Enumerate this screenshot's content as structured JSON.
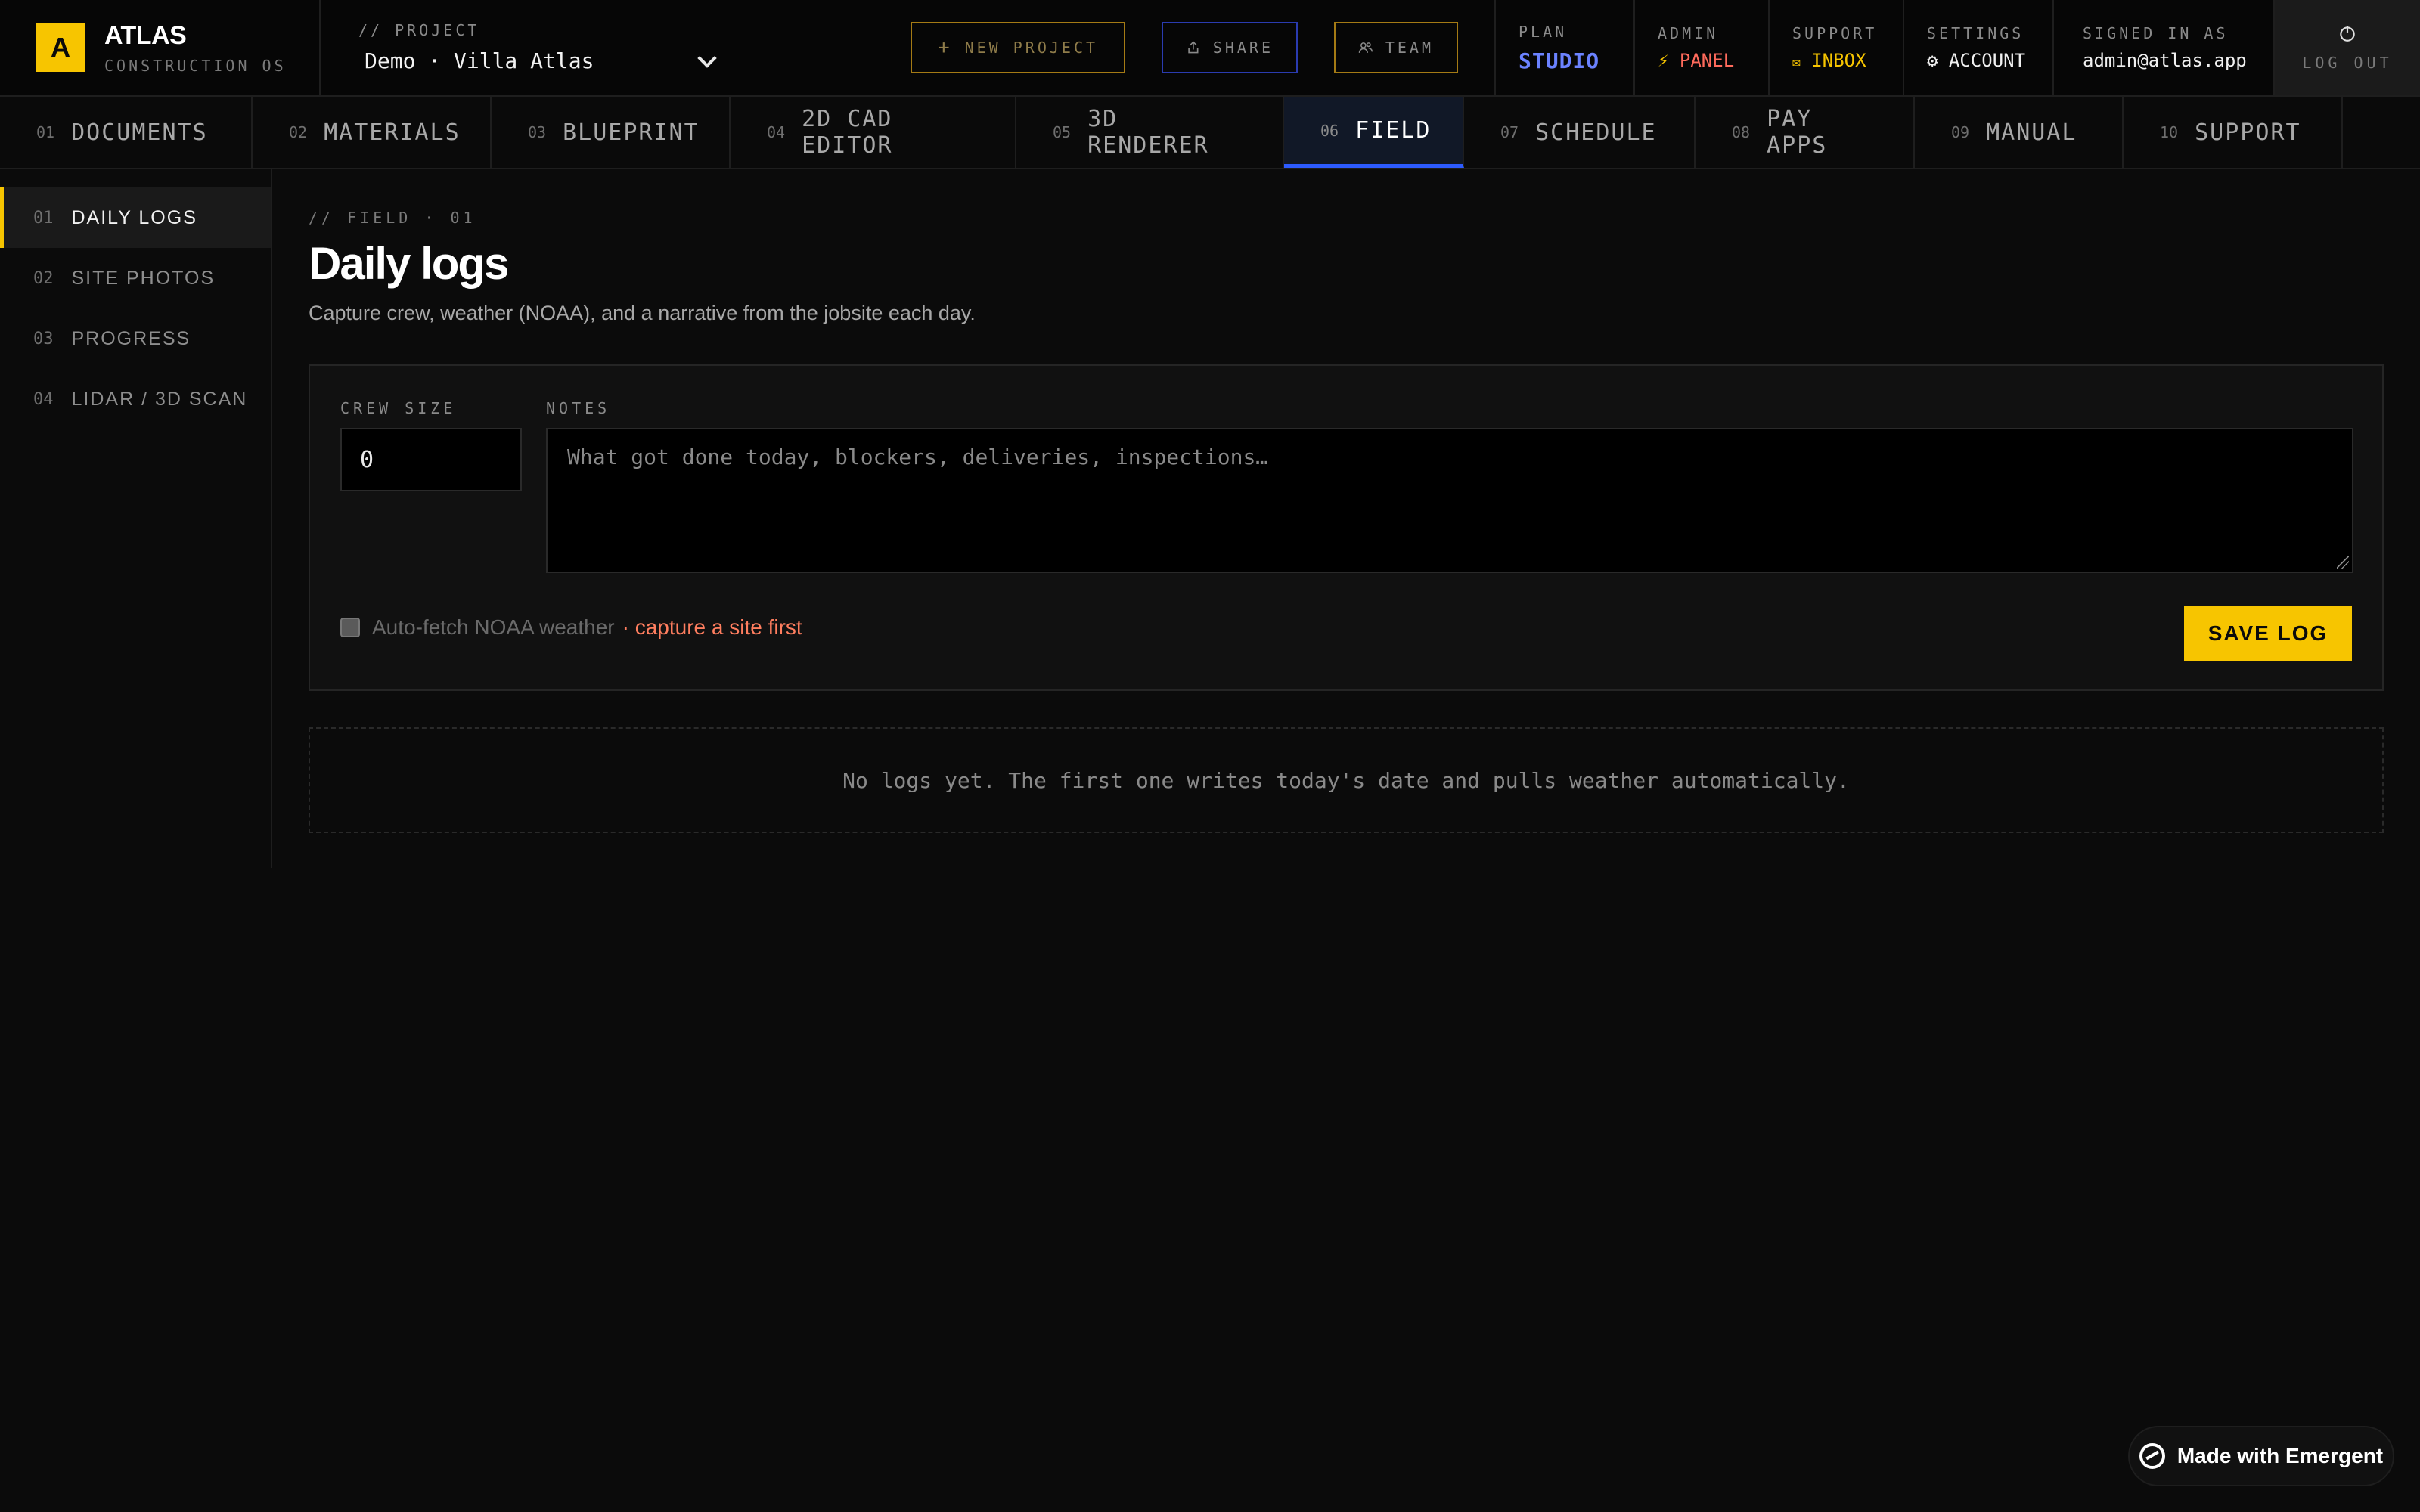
{
  "brand": {
    "logo_letter": "A",
    "name": "ATLAS",
    "subtitle": "CONSTRUCTION OS"
  },
  "project": {
    "label": "// PROJECT",
    "value": "Demo · Villa Atlas"
  },
  "actions": {
    "new_project": "NEW PROJECT",
    "share": "SHARE",
    "team": "TEAM"
  },
  "meta": {
    "plan": {
      "label": "PLAN",
      "value": "STUDIO"
    },
    "admin": {
      "label": "ADMIN",
      "value": "PANEL",
      "icon": "bolt-icon"
    },
    "support": {
      "label": "SUPPORT",
      "value": "INBOX",
      "icon": "mail-icon"
    },
    "settings": {
      "label": "SETTINGS",
      "value": "ACCOUNT",
      "icon": "gear-icon"
    },
    "signed": {
      "label": "SIGNED IN AS",
      "value": "admin@atlas.app"
    },
    "logout": {
      "label": "LOG OUT",
      "icon": "logout-icon"
    }
  },
  "tabs": [
    {
      "num": "01",
      "label": "DOCUMENTS"
    },
    {
      "num": "02",
      "label": "MATERIALS"
    },
    {
      "num": "03",
      "label": "BLUEPRINT"
    },
    {
      "num": "04",
      "label": "2D CAD EDITOR"
    },
    {
      "num": "05",
      "label": "3D RENDERER"
    },
    {
      "num": "06",
      "label": "FIELD",
      "active": true
    },
    {
      "num": "07",
      "label": "SCHEDULE"
    },
    {
      "num": "08",
      "label": "PAY APPS"
    },
    {
      "num": "09",
      "label": "MANUAL"
    },
    {
      "num": "10",
      "label": "SUPPORT"
    }
  ],
  "sidebar": {
    "items": [
      {
        "num": "01",
        "label": "DAILY LOGS",
        "active": true
      },
      {
        "num": "02",
        "label": "SITE PHOTOS"
      },
      {
        "num": "03",
        "label": "PROGRESS"
      },
      {
        "num": "04",
        "label": "LIDAR / 3D SCAN"
      }
    ]
  },
  "main": {
    "crumb": "// FIELD · 01",
    "title": "Daily logs",
    "subtitle": "Capture crew, weather (NOAA), and a narrative from the jobsite each day.",
    "form": {
      "crew_label": "CREW SIZE",
      "crew_value": "0",
      "notes_label": "NOTES",
      "notes_placeholder": "What got done today, blockers, deliveries, inspections…",
      "weather_label": "Auto-fetch NOAA weather",
      "weather_warning": "· capture a site first",
      "weather_checked": false,
      "save_label": "SAVE LOG"
    },
    "empty_state": "No logs yet. The first one writes today's date and pulls weather automatically."
  },
  "badge": {
    "label": "Made with Emergent"
  },
  "colors": {
    "accent": "#f7c500",
    "active_tab": "#2d5bff",
    "plan": "#6b82ff",
    "warning": "#ff7e5f",
    "background": "#0b0b0b"
  }
}
